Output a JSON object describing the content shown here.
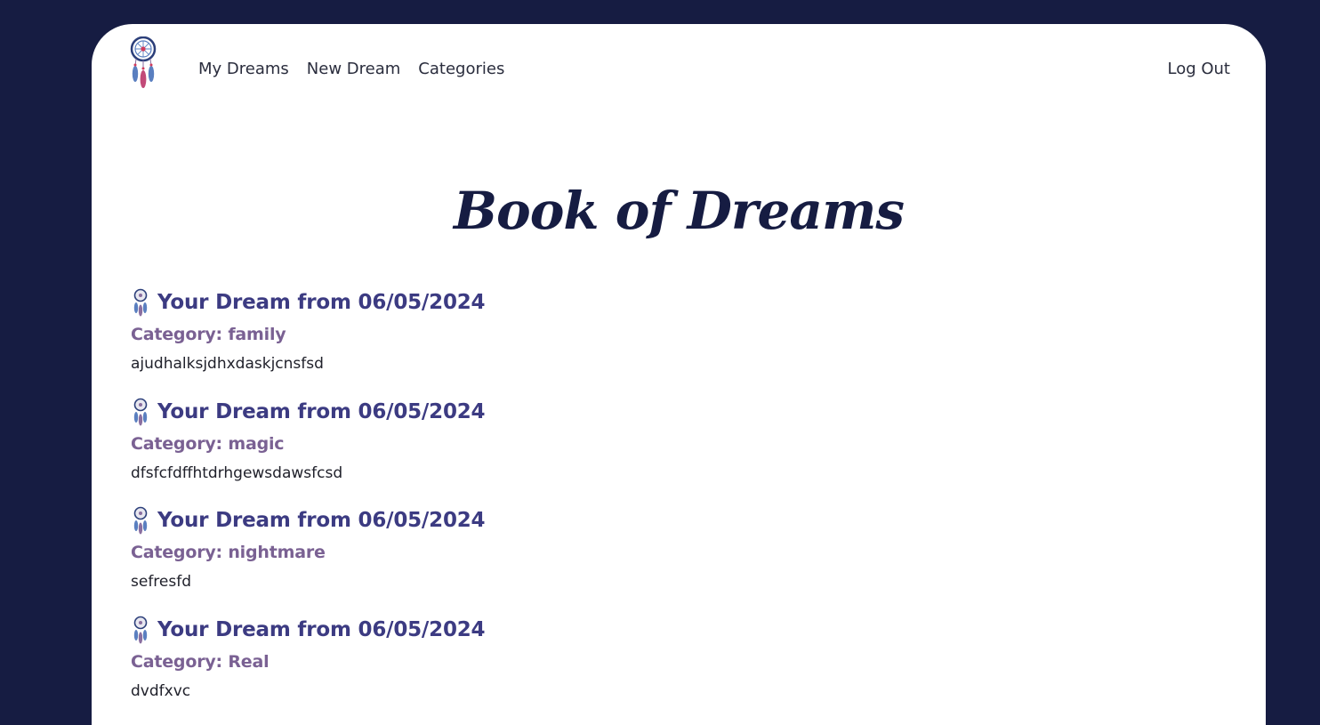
{
  "nav": {
    "links": [
      {
        "label": "My Dreams"
      },
      {
        "label": "New Dream"
      },
      {
        "label": "Categories"
      }
    ],
    "logout_label": "Log Out"
  },
  "page": {
    "title": "Book of Dreams"
  },
  "dreams": [
    {
      "title": "Your Dream from 06/05/2024",
      "category": "Category: family",
      "text": "ajudhalksjdhxdaskjcnsfsd"
    },
    {
      "title": "Your Dream from 06/05/2024",
      "category": "Category: magic",
      "text": "dfsfcfdffhtdrhgewsdawsfcsd"
    },
    {
      "title": "Your Dream from 06/05/2024",
      "category": "Category: nightmare",
      "text": "sefresfd"
    },
    {
      "title": "Your Dream from 06/05/2024",
      "category": "Category: Real",
      "text": "dvdfxvc"
    }
  ],
  "colors": {
    "background": "#161c42",
    "card": "#ffffff",
    "title": "#161c42",
    "dream_title": "#3c3b82",
    "category": "#7a6193"
  },
  "icons": {
    "logo": "dreamcatcher-icon",
    "entry": "dreamcatcher-icon"
  }
}
